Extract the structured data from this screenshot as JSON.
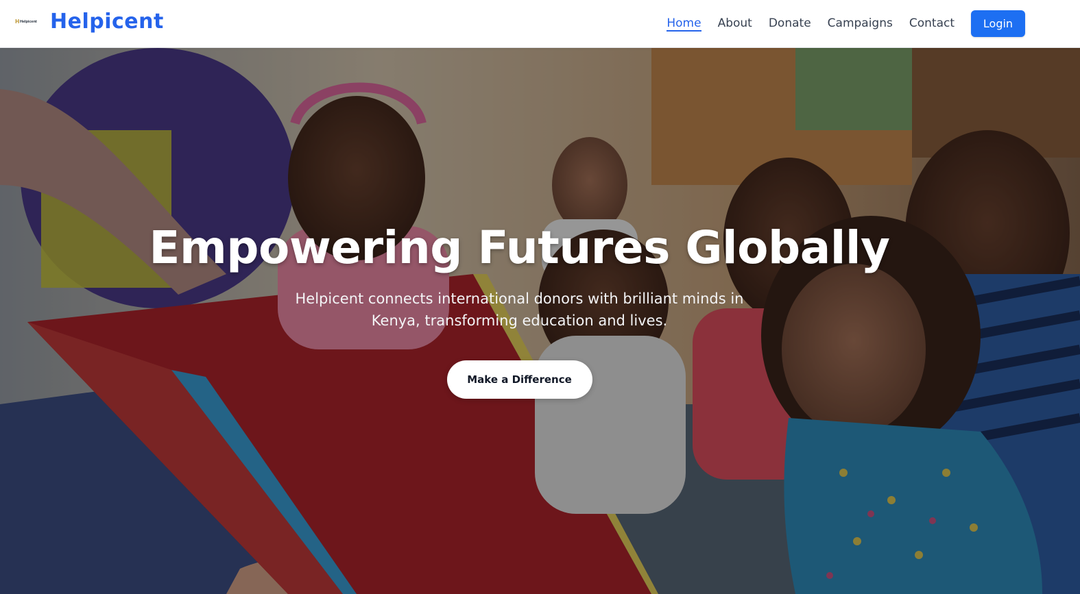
{
  "brand": {
    "logo_text": "Helpicent",
    "name": "Helpicent"
  },
  "nav": {
    "links": [
      {
        "label": "Home",
        "active": true
      },
      {
        "label": "About"
      },
      {
        "label": "Donate"
      },
      {
        "label": "Campaigns"
      },
      {
        "label": "Contact"
      }
    ],
    "login_label": "Login"
  },
  "hero": {
    "title": "Empowering Futures Globally",
    "subtitle": "Helpicent connects international donors with brilliant minds in Kenya, transforming education and lives.",
    "cta_label": "Make a Difference",
    "image": "classroom-children-reading-photo"
  },
  "colors": {
    "brand": "#2563eb",
    "login_bg": "#1d6ff2"
  }
}
